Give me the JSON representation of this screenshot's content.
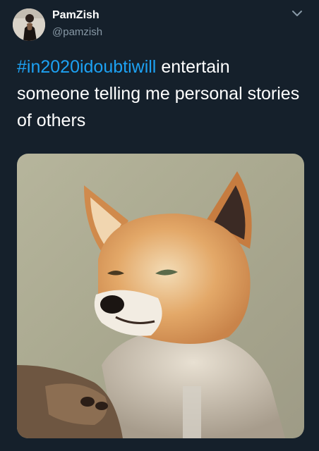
{
  "user": {
    "display_name": "PamZish",
    "handle": "@pamzish",
    "avatar_icon": "profile-photo"
  },
  "menu": {
    "icon": "chevron-down-icon"
  },
  "tweet": {
    "hashtag": "#in2020idoubtiwill",
    "body": " entertain someone telling me personal stories of others"
  },
  "media": {
    "subject": "fox-photo"
  },
  "colors": {
    "background": "#15202b",
    "link": "#1da1f2",
    "text": "#ffffff",
    "secondary": "#8899a6"
  }
}
